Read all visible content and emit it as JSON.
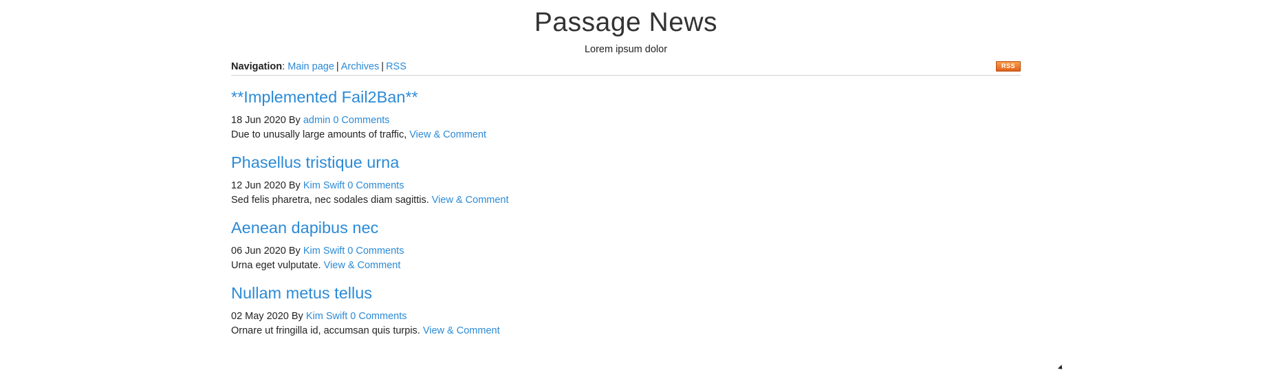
{
  "site": {
    "title": "Passage News",
    "tagline": "Lorem ipsum dolor"
  },
  "nav": {
    "label": "Navigation",
    "colon": ":",
    "separator": "|",
    "items": [
      {
        "label": "Main page"
      },
      {
        "label": "Archives"
      },
      {
        "label": "RSS"
      }
    ],
    "rss_badge": "RSS"
  },
  "posts": [
    {
      "title": "**Implemented Fail2Ban**",
      "date": "18 Jun 2020",
      "by": "By",
      "author": "admin",
      "comments": "0 Comments",
      "excerpt": "Due to unusally large amounts of traffic,",
      "action": "View & Comment"
    },
    {
      "title": "Phasellus tristique urna",
      "date": "12 Jun 2020",
      "by": "By",
      "author": "Kim Swift",
      "comments": "0 Comments",
      "excerpt": "Sed felis pharetra, nec sodales diam sagittis.",
      "action": "View & Comment"
    },
    {
      "title": "Aenean dapibus nec",
      "date": "06 Jun 2020",
      "by": "By",
      "author": "Kim Swift",
      "comments": "0 Comments",
      "excerpt": "Urna eget vulputate.",
      "action": "View & Comment"
    },
    {
      "title": "Nullam metus tellus",
      "date": "02 May 2020",
      "by": "By",
      "author": "Kim Swift",
      "comments": "0 Comments",
      "excerpt": "Ornare ut fringilla id, accumsan quis turpis.",
      "action": "View & Comment"
    }
  ],
  "colors": {
    "link": "#2b8ad6",
    "text": "#222222",
    "rss_badge": "#e2621a"
  }
}
